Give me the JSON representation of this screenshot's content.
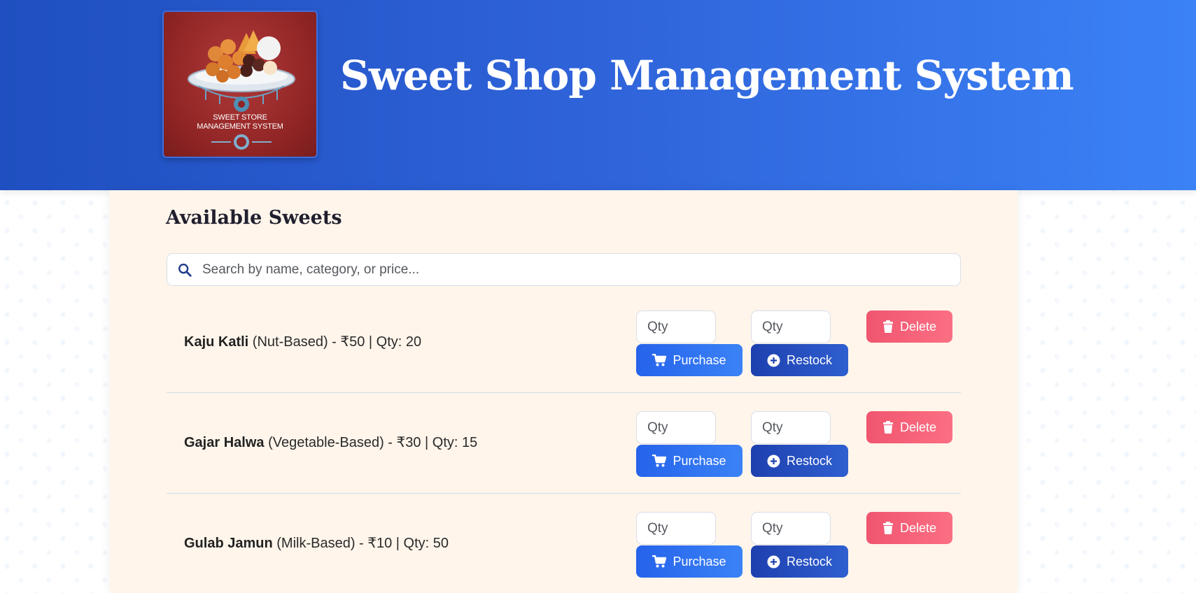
{
  "header": {
    "title": "Sweet Shop Management System",
    "logo_caption_line1": "SWEET STORE",
    "logo_caption_line2": "MANAGEMENT SYSTEM"
  },
  "main": {
    "section_title": "Available Sweets",
    "search": {
      "placeholder": "Search by name, category, or price..."
    },
    "qty_placeholder": "Qty",
    "buttons": {
      "purchase": "Purchase",
      "restock": "Restock",
      "delete": "Delete"
    },
    "sweets": [
      {
        "name": "Kaju Katli",
        "details": " (Nut-Based) - ₹50 | Qty: 20"
      },
      {
        "name": "Gajar Halwa",
        "details": " (Vegetable-Based) - ₹30 | Qty: 15"
      },
      {
        "name": "Gulab Jamun",
        "details": " (Milk-Based) - ₹10 | Qty: 50"
      }
    ]
  },
  "colors": {
    "header_gradient_start": "#1f4fc0",
    "header_gradient_end": "#3b82f6",
    "panel_bg": "#fff5eb",
    "purchase": "#2563eb",
    "restock": "#1e40af",
    "delete": "#f0556f"
  },
  "icons": {
    "search": "search-icon",
    "purchase": "cart-icon",
    "restock": "plus-circle-icon",
    "delete": "trash-icon"
  }
}
